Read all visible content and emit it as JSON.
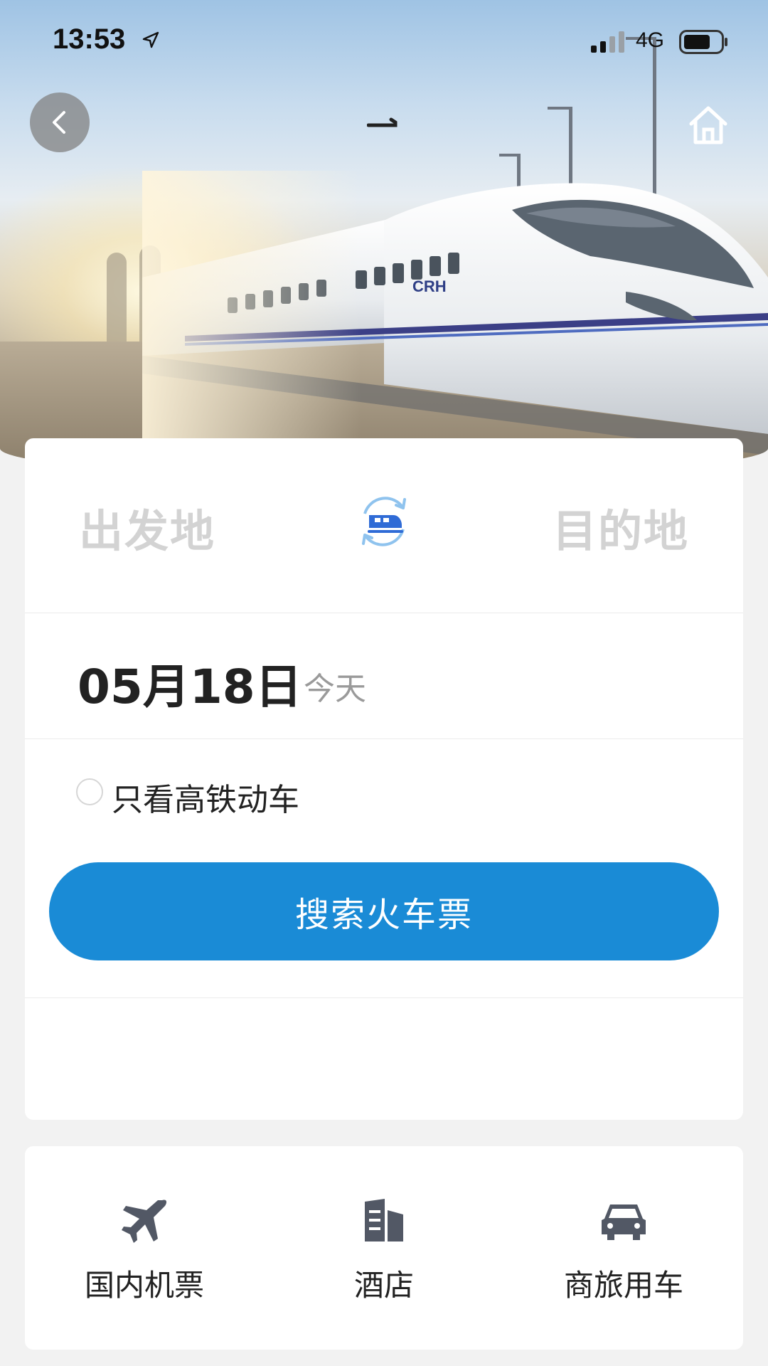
{
  "status_bar": {
    "time": "13:53",
    "network": "4G",
    "icons": [
      "location-arrow-icon",
      "signal-icon",
      "battery-icon"
    ]
  },
  "header": {
    "back_icon": "chevron-left-icon",
    "home_icon": "home-icon",
    "title_mark": "一"
  },
  "search": {
    "from_placeholder": "出发地",
    "to_placeholder": "目的地",
    "swap_icon": "train-swap-icon",
    "date": "05月18日",
    "date_hint": "今天",
    "filter_label": "只看高铁动车",
    "search_button": "搜索火车票"
  },
  "quick_links": [
    {
      "label": "国内机票",
      "icon": "airplane-icon"
    },
    {
      "label": "酒店",
      "icon": "hotel-building-icon"
    },
    {
      "label": "商旅用车",
      "icon": "car-icon"
    }
  ],
  "colors": {
    "primary": "#1a8bd6",
    "placeholder": "#d3d3d3",
    "icon_gray": "#525865",
    "background": "#f2f2f2"
  }
}
